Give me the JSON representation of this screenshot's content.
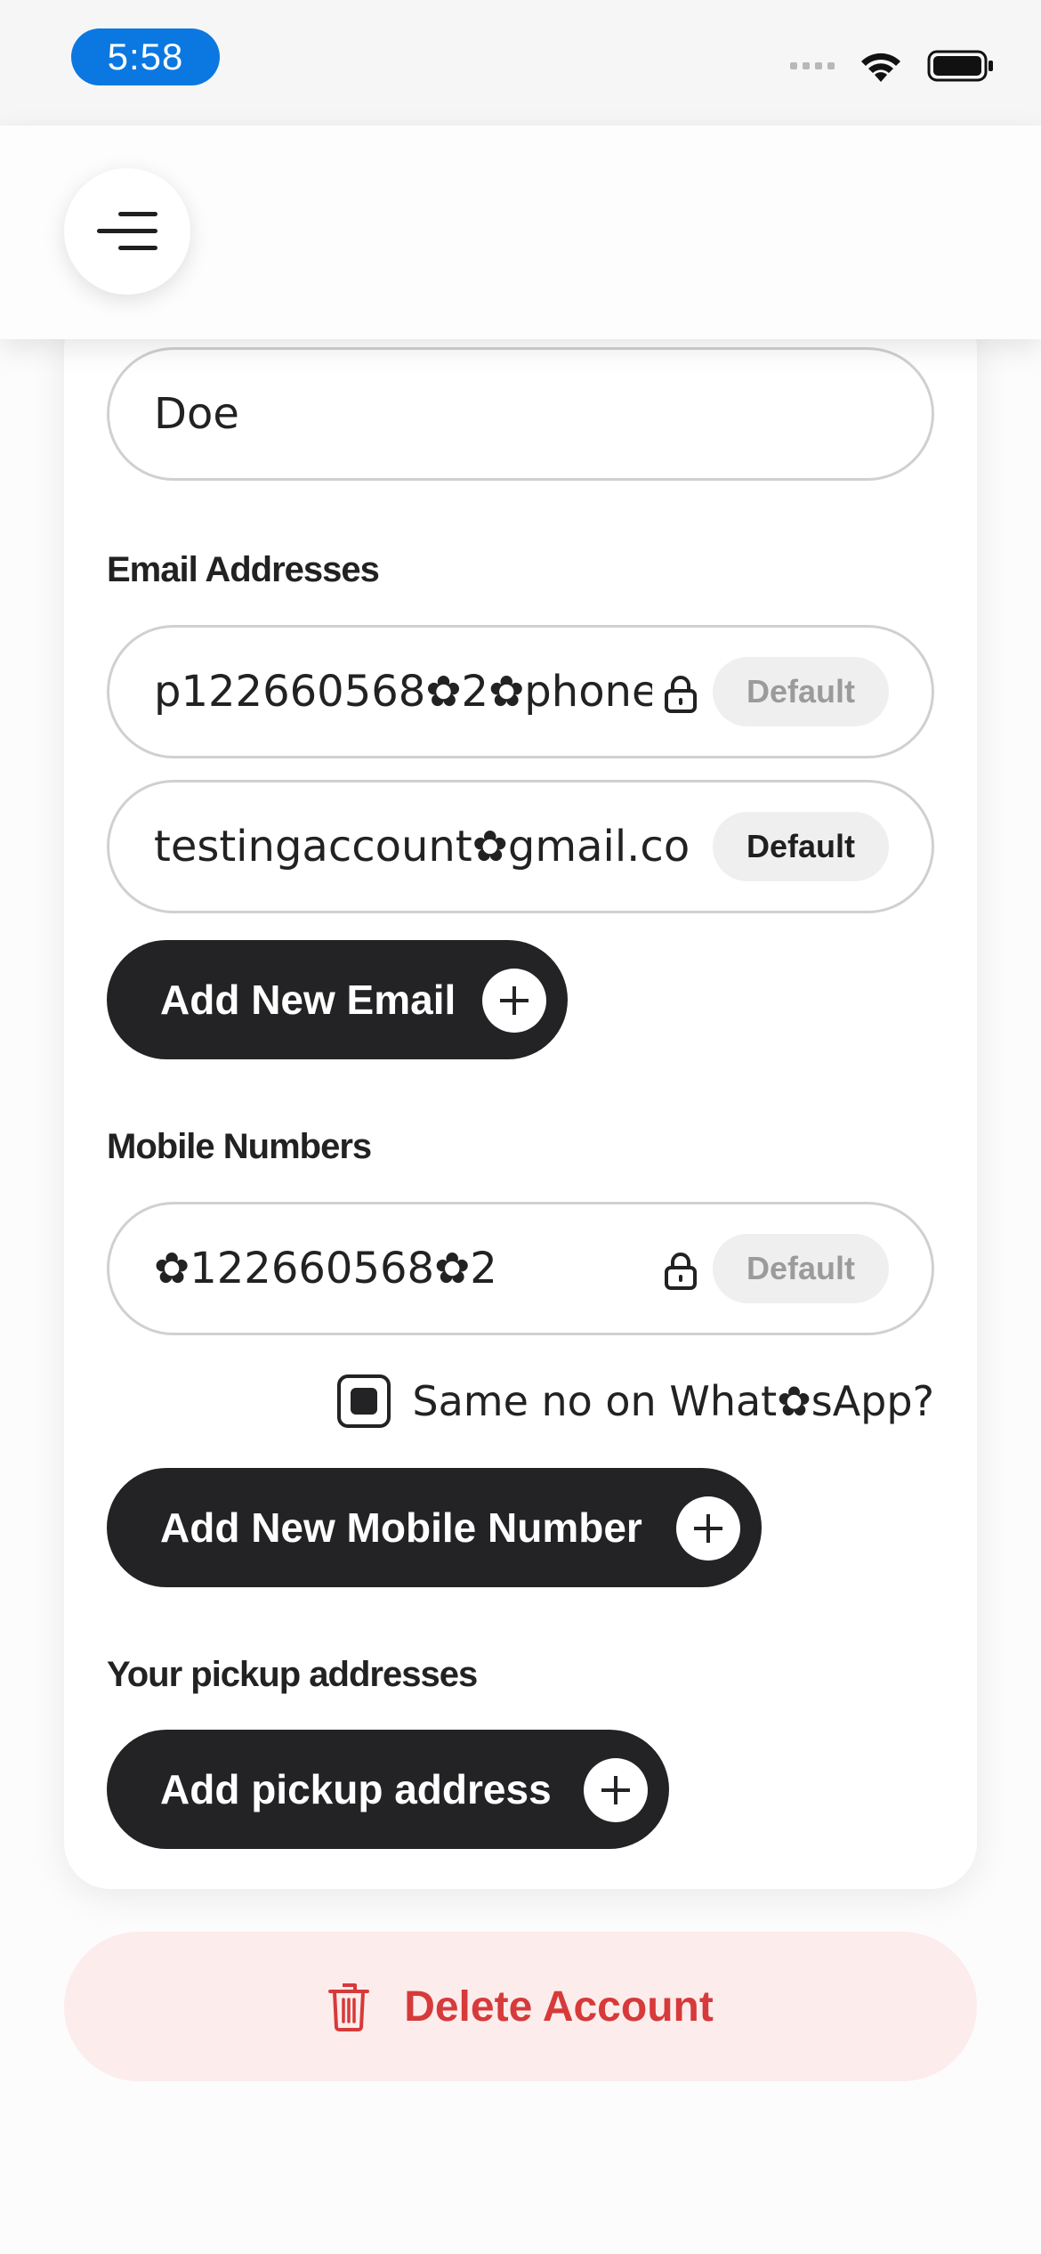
{
  "status_bar": {
    "time": "5:58"
  },
  "profile": {
    "last_name_value": "Doe",
    "emails": {
      "label": "Email Addresses",
      "items": [
        {
          "value": "p122660568✿2✿phone.",
          "default_label": "Default",
          "locked": true
        },
        {
          "value": "testingaccount✿gmail.co",
          "default_label": "Default",
          "locked": false
        }
      ],
      "add_label": "Add New Email"
    },
    "mobiles": {
      "label": "Mobile Numbers",
      "items": [
        {
          "value": "✿122660568✿2",
          "default_label": "Default",
          "locked": true
        }
      ],
      "whatsapp_label": "Same no on What✿sApp?",
      "whatsapp_checked": true,
      "add_label": "Add New Mobile Number"
    },
    "pickup": {
      "label": "Your pickup addresses",
      "add_label": "Add pickup address"
    }
  },
  "delete": {
    "label": "Delete Account",
    "color": "#d63a3a",
    "bg": "#fdecec"
  },
  "colors": {
    "primary_dark": "#232224",
    "time_pill": "#0a78e0"
  }
}
